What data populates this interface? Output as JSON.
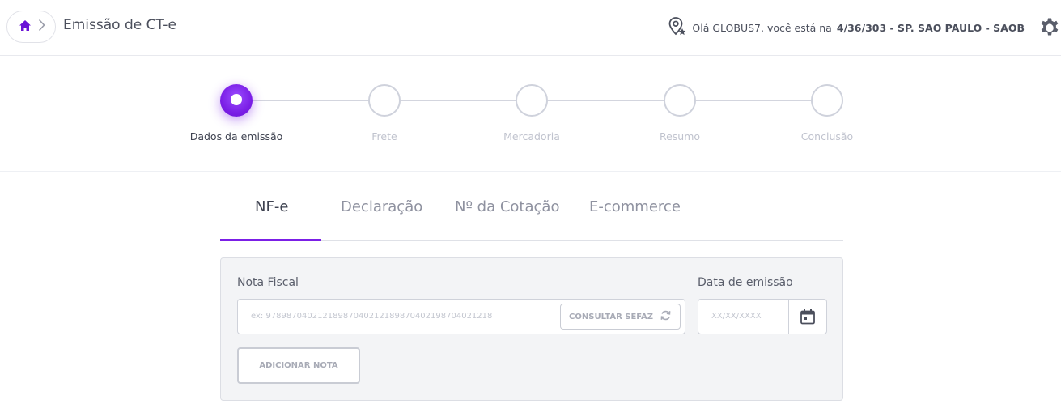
{
  "header": {
    "title": "Emissão de CT-e",
    "home_icon": "home-icon",
    "breadcrumb_icon": "chevron-right-icon",
    "location_icon": "location-pin-star-icon",
    "greeting_prefix": "Olá GLOBUS7, você está na",
    "location_code": "4/36/303 - SP. SAO PAULO - SAOB",
    "settings_icon": "gear-icon"
  },
  "stepper": {
    "steps": [
      {
        "label": "Dados da emissão",
        "active": true
      },
      {
        "label": "Frete",
        "active": false
      },
      {
        "label": "Mercadoria",
        "active": false
      },
      {
        "label": "Resumo",
        "active": false
      },
      {
        "label": "Conclusão",
        "active": false
      }
    ]
  },
  "tabs": [
    {
      "label": "NF-e",
      "active": true
    },
    {
      "label": "Declaração",
      "active": false
    },
    {
      "label": "Nº da Cotação",
      "active": false
    },
    {
      "label": "E-commerce",
      "active": false
    }
  ],
  "form": {
    "nota_fiscal_label": "Nota Fiscal",
    "nota_fiscal_placeholder": "ex: 97898704021218987040212189870402198704021218",
    "consultar_label": "CONSULTAR SEFAZ",
    "consultar_icon": "refresh-icon",
    "data_emissao_label": "Data de emissão",
    "data_placeholder": "XX/XX/XXXX",
    "calendar_icon": "calendar-icon",
    "add_note_label": "ADICIONAR NOTA"
  },
  "colors": {
    "accent": "#7b1fe6",
    "text": "#4b4f5c",
    "muted": "#c0c3ce",
    "panel_bg": "#f3f4f6"
  }
}
